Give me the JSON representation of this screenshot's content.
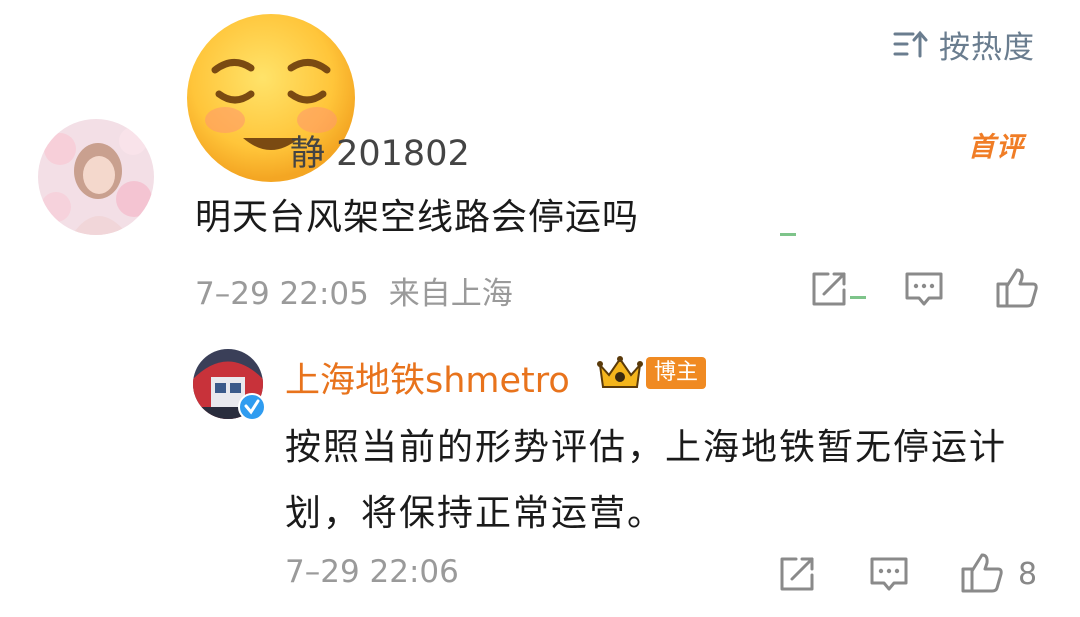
{
  "sort": {
    "label": "按热度"
  },
  "comment": {
    "username_visible": "静 201802",
    "first_badge": "首评",
    "text": "明天台风架空线路会停运吗",
    "time": "7–29 22:05",
    "location": "来自上海"
  },
  "reply": {
    "username": "上海地铁shmetro",
    "role_badge": "博主",
    "text": "按照当前的形势评估，上海地铁暂无停运计划，将保持正常运营。",
    "time": "7–29 22:06",
    "like_count": "8"
  },
  "colors": {
    "accent": "#e8731c",
    "first_badge": "#f07d26",
    "meta_text": "#9a9a9a",
    "icon": "#8a8a8a"
  }
}
